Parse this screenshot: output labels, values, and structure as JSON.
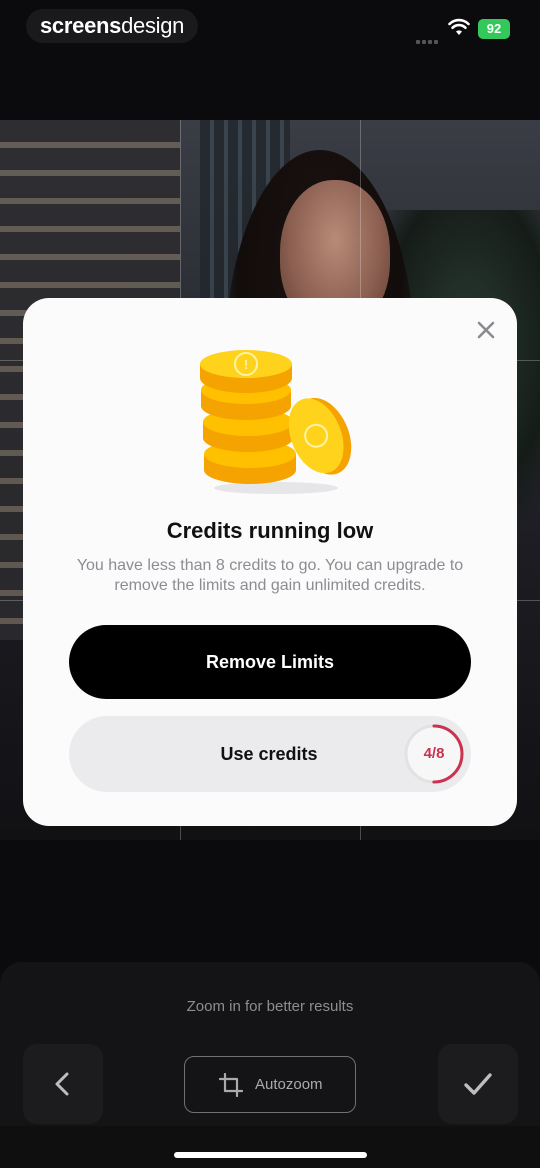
{
  "status_bar": {
    "brand_bold": "screens",
    "brand_light": "design",
    "battery": "92"
  },
  "modal": {
    "title": "Credits running low",
    "body": "You have less than 8 credits to go. You can upgrade to remove the limits and gain unlimited credits.",
    "primary_button": "Remove Limits",
    "secondary_button": "Use credits",
    "credits_display": "4/8",
    "credits_used": 4,
    "credits_total": 8,
    "accent_color": "#c9334f",
    "coin_color": "#ffc107",
    "coin_icon": "coin-stack-icon"
  },
  "editor": {
    "hint": "Zoom in for better results",
    "autozoom_label": "Autozoom",
    "back_icon": "chevron-left-icon",
    "confirm_icon": "checkmark-icon",
    "autozoom_icon": "crop-icon"
  }
}
